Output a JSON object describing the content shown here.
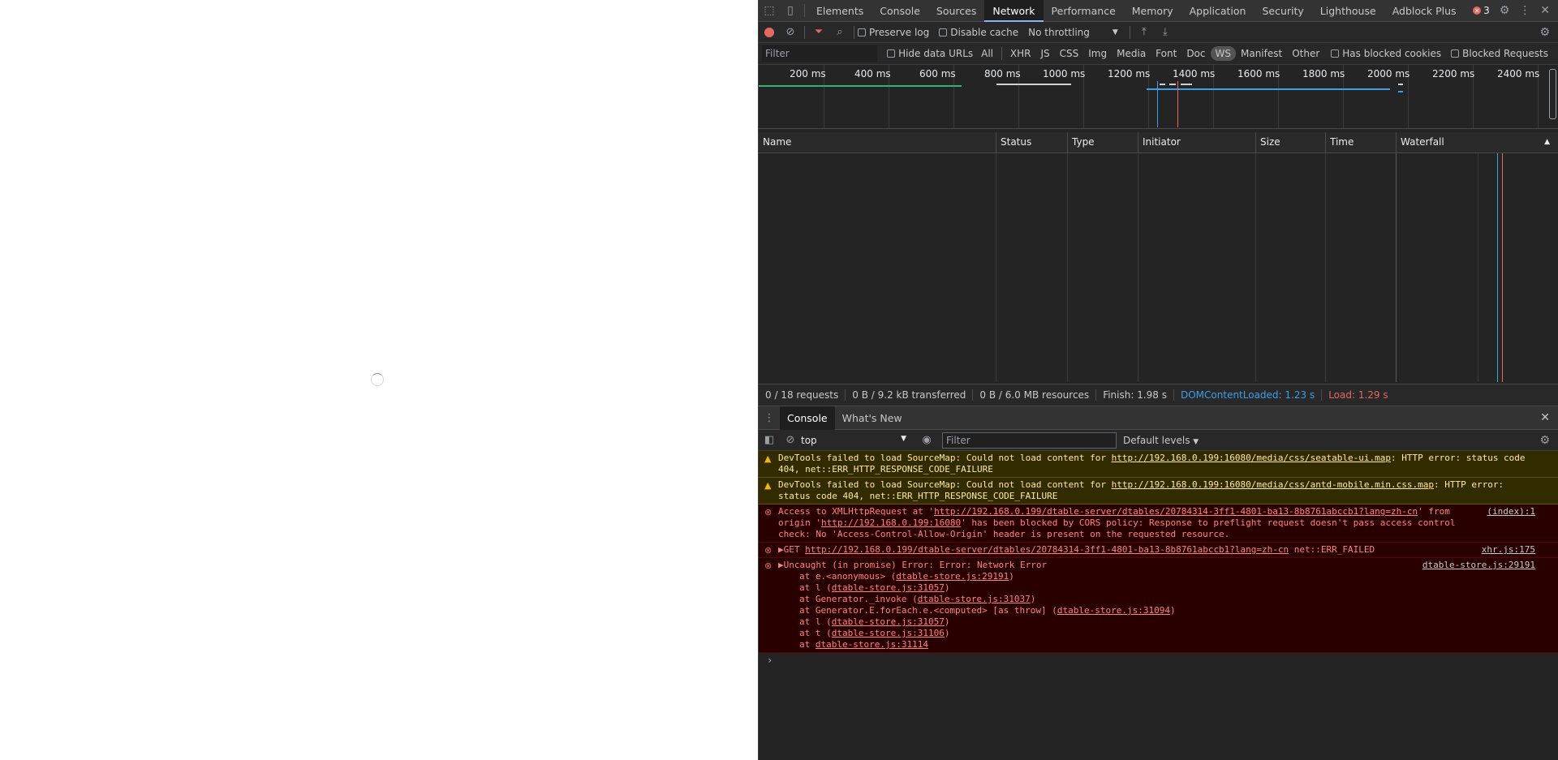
{
  "devtools": {
    "tabs": [
      "Elements",
      "Console",
      "Sources",
      "Network",
      "Performance",
      "Memory",
      "Application",
      "Security",
      "Lighthouse",
      "Adblock Plus"
    ],
    "active_tab": "Network",
    "error_count": "3"
  },
  "network_toolbar": {
    "preserve_log": "Preserve log",
    "disable_cache": "Disable cache",
    "throttling": "No throttling"
  },
  "filter_bar": {
    "filter_placeholder": "Filter",
    "hide_data_urls": "Hide data URLs",
    "types": [
      "All",
      "XHR",
      "JS",
      "CSS",
      "Img",
      "Media",
      "Font",
      "Doc",
      "WS",
      "Manifest",
      "Other"
    ],
    "has_blocked_cookies": "Has blocked cookies",
    "blocked_requests": "Blocked Requests"
  },
  "overview": {
    "ticks": [
      "200 ms",
      "400 ms",
      "600 ms",
      "800 ms",
      "1000 ms",
      "1200 ms",
      "1400 ms",
      "1600 ms",
      "1800 ms",
      "2000 ms",
      "2200 ms",
      "2400 ms"
    ]
  },
  "grid": {
    "columns": [
      "Name",
      "Status",
      "Type",
      "Initiator",
      "Size",
      "Time",
      "Waterfall"
    ]
  },
  "summary": {
    "requests": "0 / 18 requests",
    "transferred": "0 B / 9.2 kB transferred",
    "resources": "0 B / 6.0 MB resources",
    "finish": "Finish: 1.98 s",
    "dom_content_loaded": "DOMContentLoaded: 1.23 s",
    "load": "Load: 1.29 s"
  },
  "drawer": {
    "tabs": [
      "Console",
      "What's New"
    ],
    "active_tab": "Console"
  },
  "console_toolbar": {
    "context": "top",
    "filter_placeholder": "Filter",
    "levels": "Default levels"
  },
  "console": {
    "messages": [
      {
        "type": "warning",
        "prefix": "DevTools failed to load SourceMap: Could not load content for ",
        "link": "http://192.168.0.199:16080/media/css/seatable-ui.map",
        "suffix": ": HTTP error: status code 404, net::ERR_HTTP_RESPONSE_CODE_FAILURE"
      },
      {
        "type": "warning",
        "prefix": "DevTools failed to load SourceMap: Could not load content for ",
        "link": "http://192.168.0.199:16080/media/css/antd-mobile.min.css.map",
        "suffix": ": HTTP error: status code 404, net::ERR_HTTP_RESPONSE_CODE_FAILURE"
      },
      {
        "type": "error",
        "prefix": "Access to XMLHttpRequest at '",
        "link": "http://192.168.0.199/dtable-server/dtables/20784314-3ff1-4801-ba13-8b8761abccb1?lang=zh-cn",
        "mid": "' from origin '",
        "link2": "http://192.168.0.199:16080",
        "suffix": "' has been blocked by CORS policy: Response to preflight request doesn't pass access control check: No 'Access-Control-Allow-Origin' header is present on the requested resource.",
        "source": "(index):1"
      },
      {
        "type": "error",
        "prefix": "▶GET ",
        "link": "http://192.168.0.199/dtable-server/dtables/20784314-3ff1-4801-ba13-8b8761abccb1?lang=zh-cn",
        "suffix": " net::ERR_FAILED",
        "source": "xhr.js:175"
      },
      {
        "type": "error",
        "prefix": "▶Uncaught (in promise) Error: Error: Network Error",
        "source": "dtable-store.js:29191",
        "stack": [
          {
            "pre": "at e.<anonymous> (",
            "link": "dtable-store.js:29191",
            "post": ")"
          },
          {
            "pre": "at l (",
            "link": "dtable-store.js:31057",
            "post": ")"
          },
          {
            "pre": "at Generator._invoke (",
            "link": "dtable-store.js:31037",
            "post": ")"
          },
          {
            "pre": "at Generator.E.forEach.e.<computed> [as throw] (",
            "link": "dtable-store.js:31094",
            "post": ")"
          },
          {
            "pre": "at l (",
            "link": "dtable-store.js:31057",
            "post": ")"
          },
          {
            "pre": "at t (",
            "link": "dtable-store.js:31106",
            "post": ")"
          },
          {
            "pre": "at ",
            "link": "dtable-store.js:31114",
            "post": ""
          }
        ]
      }
    ]
  }
}
